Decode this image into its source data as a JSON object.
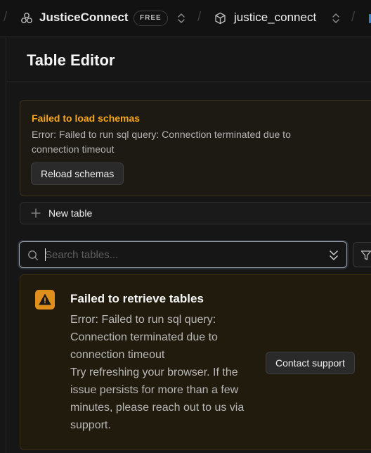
{
  "topbar": {
    "org_name": "JusticeConnect",
    "plan_badge": "FREE",
    "project_name": "justice_connect",
    "separator": "/"
  },
  "panel": {
    "title": "Table Editor"
  },
  "schema_error": {
    "title": "Failed to load schemas",
    "message": "Error: Failed to run sql query: Connection terminated due to connection timeout",
    "reload_label": "Reload schemas"
  },
  "new_table": {
    "label": "New table"
  },
  "search": {
    "placeholder": "Search tables...",
    "value": ""
  },
  "tables_error": {
    "title": "Failed to retrieve tables",
    "message": "Error: Failed to run sql query: Connection terminated due to connection timeout",
    "help": "Try refreshing your browser. If the issue persists for more than a few minutes, please reach out to us via support.",
    "contact_label": "Contact support"
  },
  "colors": {
    "warning_accent": "#f5a623",
    "warning_badge": "#e08e1c",
    "background": "#161616"
  },
  "icons": [
    "org-icon",
    "chevron-updown-icon",
    "cube-icon",
    "plus-icon",
    "search-icon",
    "chevron-collapse-icon",
    "filter-icon",
    "warning-icon"
  ]
}
